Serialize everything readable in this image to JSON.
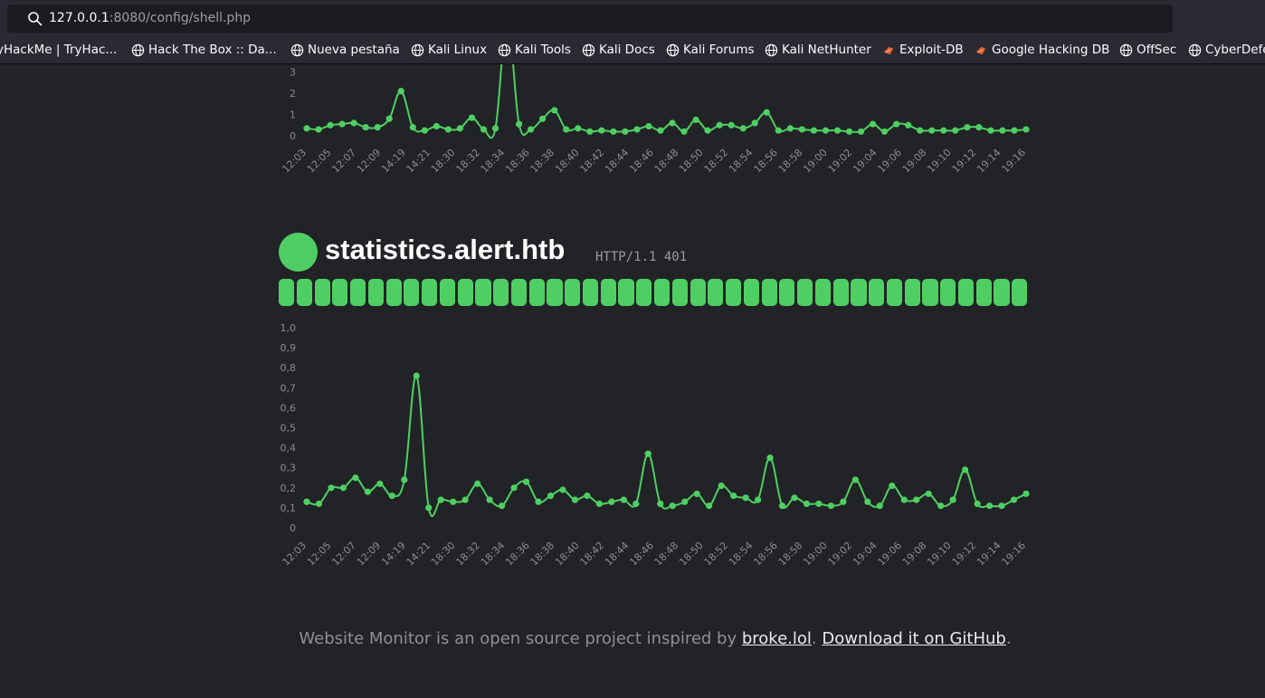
{
  "browser": {
    "url_host": "127.0.0.1",
    "url_rest": ":8080/config/shell.php",
    "bookmarks": [
      {
        "label": "yHackMe | TryHac...",
        "icon": "none"
      },
      {
        "label": "Hack The Box :: Da...",
        "icon": "globe-icon"
      },
      {
        "label": "Nueva pestaña",
        "icon": "globe-icon"
      },
      {
        "label": "Kali Linux",
        "icon": "globe-icon"
      },
      {
        "label": "Kali Tools",
        "icon": "globe-icon"
      },
      {
        "label": "Kali Docs",
        "icon": "globe-icon"
      },
      {
        "label": "Kali Forums",
        "icon": "globe-icon"
      },
      {
        "label": "Kali NetHunter",
        "icon": "globe-icon"
      },
      {
        "label": "Exploit-DB",
        "icon": "exploitdb-icon"
      },
      {
        "label": "Google Hacking DB",
        "icon": "exploitdb-icon"
      },
      {
        "label": "OffSec",
        "icon": "globe-icon"
      },
      {
        "label": "CyberDefe",
        "icon": "globe-icon"
      }
    ]
  },
  "monitor": {
    "site_name": "statistics.alert.htb",
    "http_status": "HTTP/1.1 401",
    "status_color": "#4fcf63",
    "status_bar_count": 42
  },
  "chart_data": [
    {
      "type": "line",
      "title": "",
      "xlabel": "",
      "ylabel": "",
      "y_ticks_visible": [
        "0",
        "1",
        "2",
        "3"
      ],
      "x_tick_labels": [
        "12:03",
        "12:05",
        "12:07",
        "12:09",
        "14:19",
        "14:21",
        "18:30",
        "18:32",
        "18:34",
        "18:36",
        "18:38",
        "18:40",
        "18:42",
        "18:44",
        "18:46",
        "18:48",
        "18:50",
        "18:52",
        "18:54",
        "18:56",
        "18:58",
        "19:00",
        "19:02",
        "19:04",
        "19:06",
        "19:08",
        "19:10",
        "19:12",
        "19:14",
        "19:16"
      ],
      "values": [
        0.35,
        0.3,
        0.5,
        0.55,
        0.6,
        0.4,
        0.4,
        0.8,
        2.1,
        0.4,
        0.25,
        0.45,
        0.3,
        0.35,
        0.85,
        0.3,
        0.35,
        5.5,
        0.55,
        0.3,
        0.8,
        1.2,
        0.3,
        0.35,
        0.2,
        0.25,
        0.2,
        0.2,
        0.3,
        0.45,
        0.25,
        0.6,
        0.2,
        0.75,
        0.25,
        0.5,
        0.5,
        0.35,
        0.6,
        1.1,
        0.25,
        0.35,
        0.3,
        0.25,
        0.25,
        0.25,
        0.2,
        0.2,
        0.55,
        0.2,
        0.55,
        0.5,
        0.25,
        0.25,
        0.25,
        0.25,
        0.4,
        0.4,
        0.25,
        0.25,
        0.25,
        0.3
      ],
      "color": "#4fcf63"
    },
    {
      "type": "line",
      "title": "",
      "xlabel": "",
      "ylabel": "",
      "y_ticks": [
        "0",
        "0,1",
        "0,2",
        "0,3",
        "0,4",
        "0,5",
        "0,6",
        "0,7",
        "0,8",
        "0,9",
        "1,0"
      ],
      "ylim": [
        0,
        1.0
      ],
      "x_tick_labels": [
        "12:03",
        "12:05",
        "12:07",
        "12:09",
        "14:19",
        "14:21",
        "18:30",
        "18:32",
        "18:34",
        "18:36",
        "18:38",
        "18:40",
        "18:42",
        "18:44",
        "18:46",
        "18:48",
        "18:50",
        "18:52",
        "18:54",
        "18:56",
        "18:58",
        "19:00",
        "19:02",
        "19:04",
        "19:06",
        "19:08",
        "19:10",
        "19:12",
        "19:14",
        "19:16"
      ],
      "values": [
        0.13,
        0.12,
        0.2,
        0.2,
        0.25,
        0.18,
        0.22,
        0.16,
        0.24,
        0.76,
        0.1,
        0.14,
        0.13,
        0.14,
        0.22,
        0.14,
        0.11,
        0.2,
        0.23,
        0.13,
        0.16,
        0.19,
        0.14,
        0.16,
        0.12,
        0.13,
        0.14,
        0.12,
        0.37,
        0.12,
        0.11,
        0.13,
        0.17,
        0.11,
        0.21,
        0.16,
        0.15,
        0.14,
        0.35,
        0.11,
        0.15,
        0.12,
        0.12,
        0.11,
        0.13,
        0.24,
        0.13,
        0.11,
        0.21,
        0.14,
        0.14,
        0.17,
        0.11,
        0.14,
        0.29,
        0.12,
        0.11,
        0.11,
        0.14,
        0.17
      ],
      "color": "#4fcf63"
    }
  ],
  "footer": {
    "prefix": "Website Monitor is an open source project inspired by ",
    "link1": "broke.lol",
    "middle": ". ",
    "link2": "Download it on GitHub",
    "suffix": "."
  }
}
